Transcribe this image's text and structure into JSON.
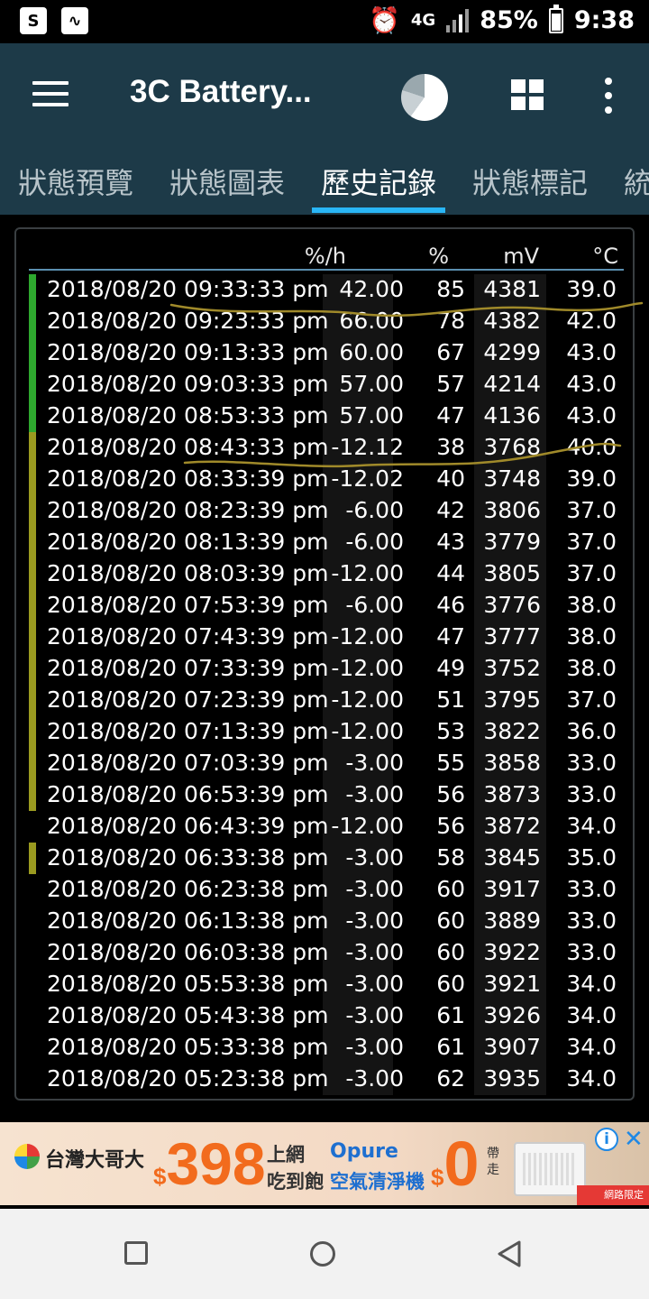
{
  "status_bar": {
    "left_icons": [
      "shopping-bag-icon",
      "activity-icon"
    ],
    "network": "4G",
    "battery_percent": "85%",
    "time": "9:38"
  },
  "app_bar": {
    "title": "3C Battery..."
  },
  "tabs": [
    {
      "label": "狀態預覽",
      "active": false
    },
    {
      "label": "狀態圖表",
      "active": false
    },
    {
      "label": "歷史記錄",
      "active": true
    },
    {
      "label": "狀態標記",
      "active": false
    },
    {
      "label": "統",
      "active": false
    }
  ],
  "table": {
    "headers": {
      "rate": "%/h",
      "pct": "%",
      "mv": "mV",
      "temp": "°C"
    },
    "marker_colors": {
      "charging": "#2ea82e",
      "discharging": "#9a9a20"
    },
    "rows": [
      {
        "time": "2018/08/20 09:33:33 pm",
        "rate": "42.00",
        "pct": "85",
        "mv": "4381",
        "temp": "39.0",
        "marker": "charging"
      },
      {
        "time": "2018/08/20 09:23:33 pm",
        "rate": "66.00",
        "pct": "78",
        "mv": "4382",
        "temp": "42.0",
        "marker": "charging"
      },
      {
        "time": "2018/08/20 09:13:33 pm",
        "rate": "60.00",
        "pct": "67",
        "mv": "4299",
        "temp": "43.0",
        "marker": "charging"
      },
      {
        "time": "2018/08/20 09:03:33 pm",
        "rate": "57.00",
        "pct": "57",
        "mv": "4214",
        "temp": "43.0",
        "marker": "charging"
      },
      {
        "time": "2018/08/20 08:53:33 pm",
        "rate": "57.00",
        "pct": "47",
        "mv": "4136",
        "temp": "43.0",
        "marker": "charging"
      },
      {
        "time": "2018/08/20 08:43:33 pm",
        "rate": "-12.12",
        "pct": "38",
        "mv": "3768",
        "temp": "40.0",
        "marker": "discharging"
      },
      {
        "time": "2018/08/20 08:33:39 pm",
        "rate": "-12.02",
        "pct": "40",
        "mv": "3748",
        "temp": "39.0",
        "marker": "discharging"
      },
      {
        "time": "2018/08/20 08:23:39 pm",
        "rate": "-6.00",
        "pct": "42",
        "mv": "3806",
        "temp": "37.0",
        "marker": "discharging"
      },
      {
        "time": "2018/08/20 08:13:39 pm",
        "rate": "-6.00",
        "pct": "43",
        "mv": "3779",
        "temp": "37.0",
        "marker": "discharging"
      },
      {
        "time": "2018/08/20 08:03:39 pm",
        "rate": "-12.00",
        "pct": "44",
        "mv": "3805",
        "temp": "37.0",
        "marker": "discharging"
      },
      {
        "time": "2018/08/20 07:53:39 pm",
        "rate": "-6.00",
        "pct": "46",
        "mv": "3776",
        "temp": "38.0",
        "marker": "discharging"
      },
      {
        "time": "2018/08/20 07:43:39 pm",
        "rate": "-12.00",
        "pct": "47",
        "mv": "3777",
        "temp": "38.0",
        "marker": "discharging"
      },
      {
        "time": "2018/08/20 07:33:39 pm",
        "rate": "-12.00",
        "pct": "49",
        "mv": "3752",
        "temp": "38.0",
        "marker": "discharging"
      },
      {
        "time": "2018/08/20 07:23:39 pm",
        "rate": "-12.00",
        "pct": "51",
        "mv": "3795",
        "temp": "37.0",
        "marker": "discharging"
      },
      {
        "time": "2018/08/20 07:13:39 pm",
        "rate": "-12.00",
        "pct": "53",
        "mv": "3822",
        "temp": "36.0",
        "marker": "discharging"
      },
      {
        "time": "2018/08/20 07:03:39 pm",
        "rate": "-3.00",
        "pct": "55",
        "mv": "3858",
        "temp": "33.0",
        "marker": "discharging"
      },
      {
        "time": "2018/08/20 06:53:39 pm",
        "rate": "-3.00",
        "pct": "56",
        "mv": "3873",
        "temp": "33.0",
        "marker": "discharging"
      },
      {
        "time": "2018/08/20 06:43:39 pm",
        "rate": "-12.00",
        "pct": "56",
        "mv": "3872",
        "temp": "34.0",
        "marker": ""
      },
      {
        "time": "2018/08/20 06:33:38 pm",
        "rate": "-3.00",
        "pct": "58",
        "mv": "3845",
        "temp": "35.0",
        "marker": "discharging"
      },
      {
        "time": "2018/08/20 06:23:38 pm",
        "rate": "-3.00",
        "pct": "60",
        "mv": "3917",
        "temp": "33.0",
        "marker": ""
      },
      {
        "time": "2018/08/20 06:13:38 pm",
        "rate": "-3.00",
        "pct": "60",
        "mv": "3889",
        "temp": "33.0",
        "marker": ""
      },
      {
        "time": "2018/08/20 06:03:38 pm",
        "rate": "-3.00",
        "pct": "60",
        "mv": "3922",
        "temp": "33.0",
        "marker": ""
      },
      {
        "time": "2018/08/20 05:53:38 pm",
        "rate": "-3.00",
        "pct": "60",
        "mv": "3921",
        "temp": "34.0",
        "marker": ""
      },
      {
        "time": "2018/08/20 05:43:38 pm",
        "rate": "-3.00",
        "pct": "61",
        "mv": "3926",
        "temp": "34.0",
        "marker": ""
      },
      {
        "time": "2018/08/20 05:33:38 pm",
        "rate": "-3.00",
        "pct": "61",
        "mv": "3907",
        "temp": "34.0",
        "marker": ""
      },
      {
        "time": "2018/08/20 05:23:38 pm",
        "rate": "-3.00",
        "pct": "62",
        "mv": "3935",
        "temp": "34.0",
        "marker": ""
      }
    ]
  },
  "ad": {
    "brand": "台灣大哥大",
    "currency": "$",
    "price": "398",
    "line1": "上網",
    "line2": "吃到飽",
    "product_brand": "Opure",
    "product": "空氣清淨機",
    "zero": "0",
    "note": "帶走",
    "corner": "網路限定"
  },
  "colors": {
    "app_bar": "#1d3a48",
    "tab_indicator": "#29b6f6",
    "scribble": "#a08a2a"
  }
}
